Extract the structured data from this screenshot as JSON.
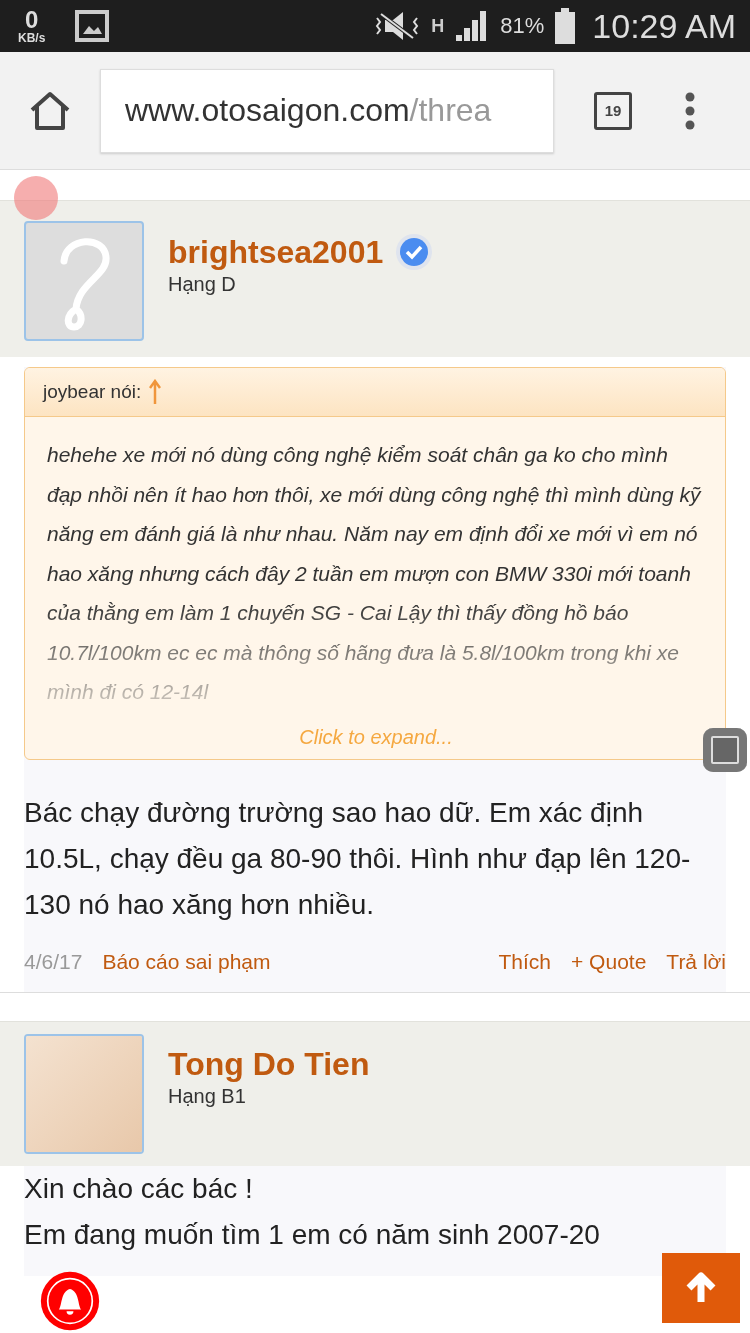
{
  "status_bar": {
    "speed": "0",
    "speed_unit": "KB/s",
    "network": "H",
    "battery": "81%",
    "time": "10:29 AM"
  },
  "browser": {
    "url_host": "www.otosaigon.com",
    "url_path": "/threa",
    "tab_count": "19"
  },
  "posts": [
    {
      "username": "brightsea2001",
      "verified": true,
      "rank": "Hạng D",
      "avatar": {
        "kind": "placeholder"
      },
      "quote": {
        "author": "joybear nói:",
        "text": "hehehe xe mới nó dùng công nghệ kiểm soát chân ga ko cho mình đạp nhồi nên ít hao hơn thôi, xe mới dùng công nghệ thì mình dùng kỹ năng em đánh giá là như nhau. Năm nay em định đổi xe mới vì em nó hao xăng nhưng cách đây 2 tuần em mượn con BMW 330i mới toanh của thằng em làm 1 chuyến SG - Cai Lậy thì thấy đồng hồ báo 10.7l/100km ec ec mà thông số hãng đưa là 5.8l/100km trong khi xe mình đi có 12-14l",
        "expand": "Click to expand..."
      },
      "body": [
        "Bác chạy đường trường sao hao dữ. Em xác định 10.5L, chạy đều ga 80-90 thôi. Hình như đạp lên 120-130 nó hao xăng hơn nhiều."
      ],
      "date": "4/6/17",
      "report": "Báo cáo sai phạm",
      "actions": [
        "Thích",
        "+ Quote",
        "Trả lời"
      ]
    },
    {
      "username": "Tong Do Tien",
      "verified": false,
      "rank": "Hạng B1",
      "avatar": {
        "kind": "photo"
      },
      "body": [
        "Xin chào các bác !",
        "Em đang muốn tìm 1 em có năm sinh 2007-20"
      ]
    }
  ]
}
